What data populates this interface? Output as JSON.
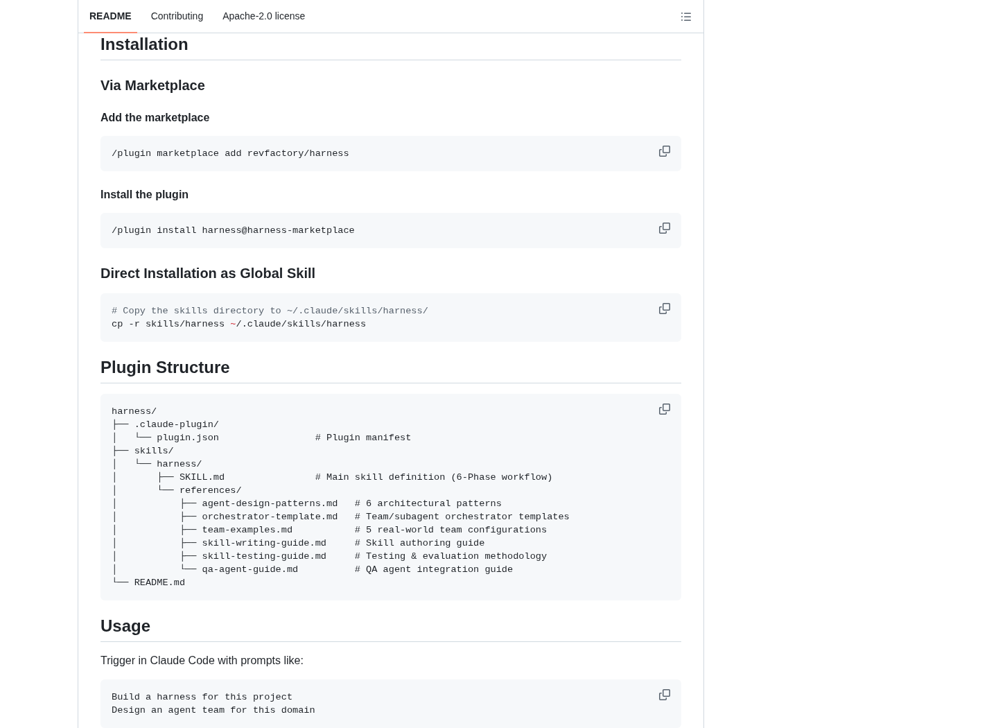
{
  "tabs": [
    {
      "label": "README",
      "selected": true
    },
    {
      "label": "Contributing",
      "selected": false
    },
    {
      "label": "Apache-2.0 license",
      "selected": false
    }
  ],
  "content": [
    {
      "kind": "h2",
      "text": "Installation"
    },
    {
      "kind": "h3",
      "text": "Via Marketplace"
    },
    {
      "kind": "h4",
      "text": "Add the marketplace"
    },
    {
      "kind": "code",
      "lines": [
        "/plugin marketplace add revfactory/harness"
      ]
    },
    {
      "kind": "h4",
      "text": "Install the plugin"
    },
    {
      "kind": "code",
      "lines": [
        "/plugin install harness@harness-marketplace"
      ]
    },
    {
      "kind": "h3",
      "text": "Direct Installation as Global Skill"
    },
    {
      "kind": "code",
      "lines": [
        [
          {
            "text": "# Copy the skills directory to ~/.claude/skills/harness/",
            "kind": "comment"
          }
        ],
        [
          {
            "text": "cp -r skills/harness ",
            "kind": "plain"
          },
          {
            "text": "~",
            "kind": "keyword"
          },
          {
            "text": "/.claude/skills/harness",
            "kind": "plain"
          }
        ]
      ]
    },
    {
      "kind": "h2",
      "text": "Plugin Structure"
    },
    {
      "kind": "code",
      "lines": [
        "harness/",
        "├── .claude-plugin/",
        "│   └── plugin.json                 # Plugin manifest",
        "├── skills/",
        "│   └── harness/",
        "│       ├── SKILL.md                # Main skill definition (6-Phase workflow)",
        "│       └── references/",
        "│           ├── agent-design-patterns.md   # 6 architectural patterns",
        "│           ├── orchestrator-template.md   # Team/subagent orchestrator templates",
        "│           ├── team-examples.md           # 5 real-world team configurations",
        "│           ├── skill-writing-guide.md     # Skill authoring guide",
        "│           ├── skill-testing-guide.md     # Testing & evaluation methodology",
        "│           └── qa-agent-guide.md          # QA agent integration guide",
        "└── README.md"
      ]
    },
    {
      "kind": "h2",
      "text": "Usage"
    },
    {
      "kind": "paragraph",
      "text": "Trigger in Claude Code with prompts like:"
    },
    {
      "kind": "code",
      "lines": [
        "Build a harness for this project",
        "Design an agent team for this domain"
      ]
    }
  ]
}
